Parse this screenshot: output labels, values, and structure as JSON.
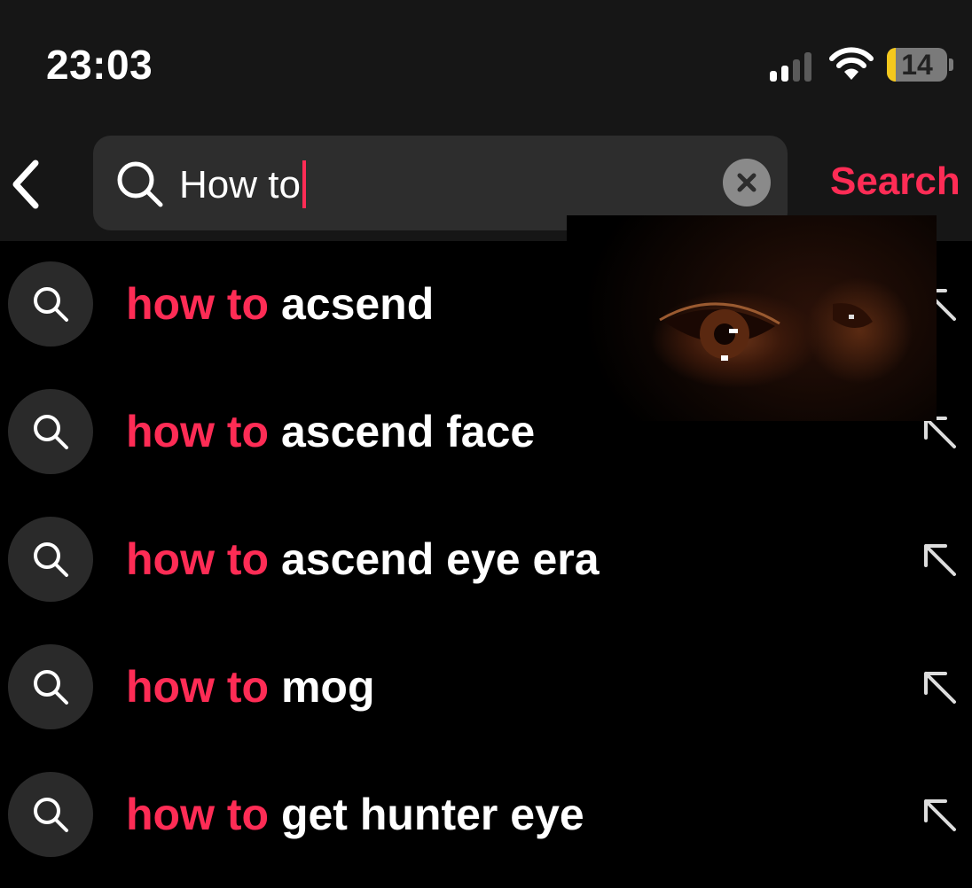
{
  "status_bar": {
    "time": "23:03",
    "battery_level": "14",
    "signal_bars_active": 2,
    "signal_bars_total": 4
  },
  "search": {
    "query": "How to",
    "button_label": "Search",
    "accent_color": "#fe2c55"
  },
  "suggestions": [
    {
      "highlight": "how to",
      "rest": " acsend"
    },
    {
      "highlight": "how to",
      "rest": " ascend face"
    },
    {
      "highlight": "how to",
      "rest": " ascend eye era"
    },
    {
      "highlight": "how to",
      "rest": " mog"
    },
    {
      "highlight": "how to",
      "rest": " get hunter eye"
    }
  ],
  "icons": {
    "back": "chevron-left-icon",
    "search": "search-icon",
    "clear": "close-icon",
    "fill_suggestion": "arrow-up-left-icon"
  }
}
